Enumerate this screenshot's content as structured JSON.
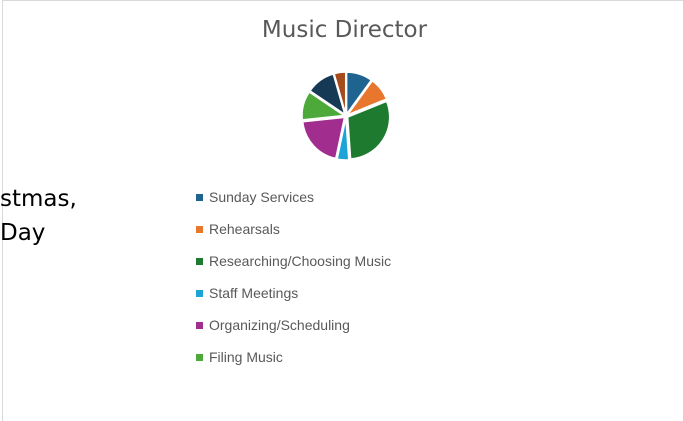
{
  "slide": {
    "text_lines": [
      "stmas,",
      "Day"
    ]
  },
  "chart_data": {
    "type": "pie",
    "title": "Music Director",
    "legend_position": "bottom",
    "start_angle_deg": 0,
    "slices": [
      {
        "label": "Sunday Services",
        "value": 9,
        "color": "#1f6391"
      },
      {
        "label": "Rehearsals",
        "value": 8,
        "color": "#e8762d"
      },
      {
        "label": "Researching/Choosing Music",
        "value": 27,
        "color": "#1e7a2e"
      },
      {
        "label": "Staff Meetings",
        "value": 4,
        "color": "#1ea3d6"
      },
      {
        "label": "Organizing/Scheduling",
        "value": 18,
        "color": "#a12d8f"
      },
      {
        "label": "Filing Music",
        "value": 10,
        "color": "#4ca93a"
      },
      {
        "label": "",
        "value": 10,
        "color": "#163a56"
      },
      {
        "label": "",
        "value": 4,
        "color": "#a64b1d"
      }
    ],
    "legend_entries": [
      "Sunday Services",
      "Rehearsals",
      "Researching/Choosing Music",
      "Staff Meetings",
      "Organizing/Scheduling",
      "Filing Music"
    ]
  }
}
